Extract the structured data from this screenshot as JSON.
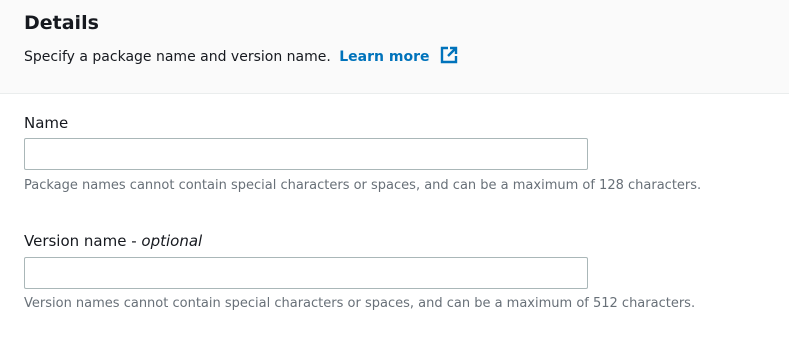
{
  "details": {
    "title": "Details",
    "description": "Specify a package name and version name.",
    "learn_more_label": "Learn more",
    "learn_more_icon": "external-link-icon",
    "accent_color": "#0073bb"
  },
  "fields": {
    "name": {
      "label": "Name",
      "value": "",
      "placeholder": "",
      "hint": "Package names cannot contain special characters or spaces, and can be a maximum of 128 characters."
    },
    "version_name": {
      "label": "Version name - ",
      "optional_label": "optional",
      "value": "",
      "placeholder": "",
      "hint": "Version names cannot contain special characters or spaces, and can be a maximum of 512 characters."
    }
  }
}
